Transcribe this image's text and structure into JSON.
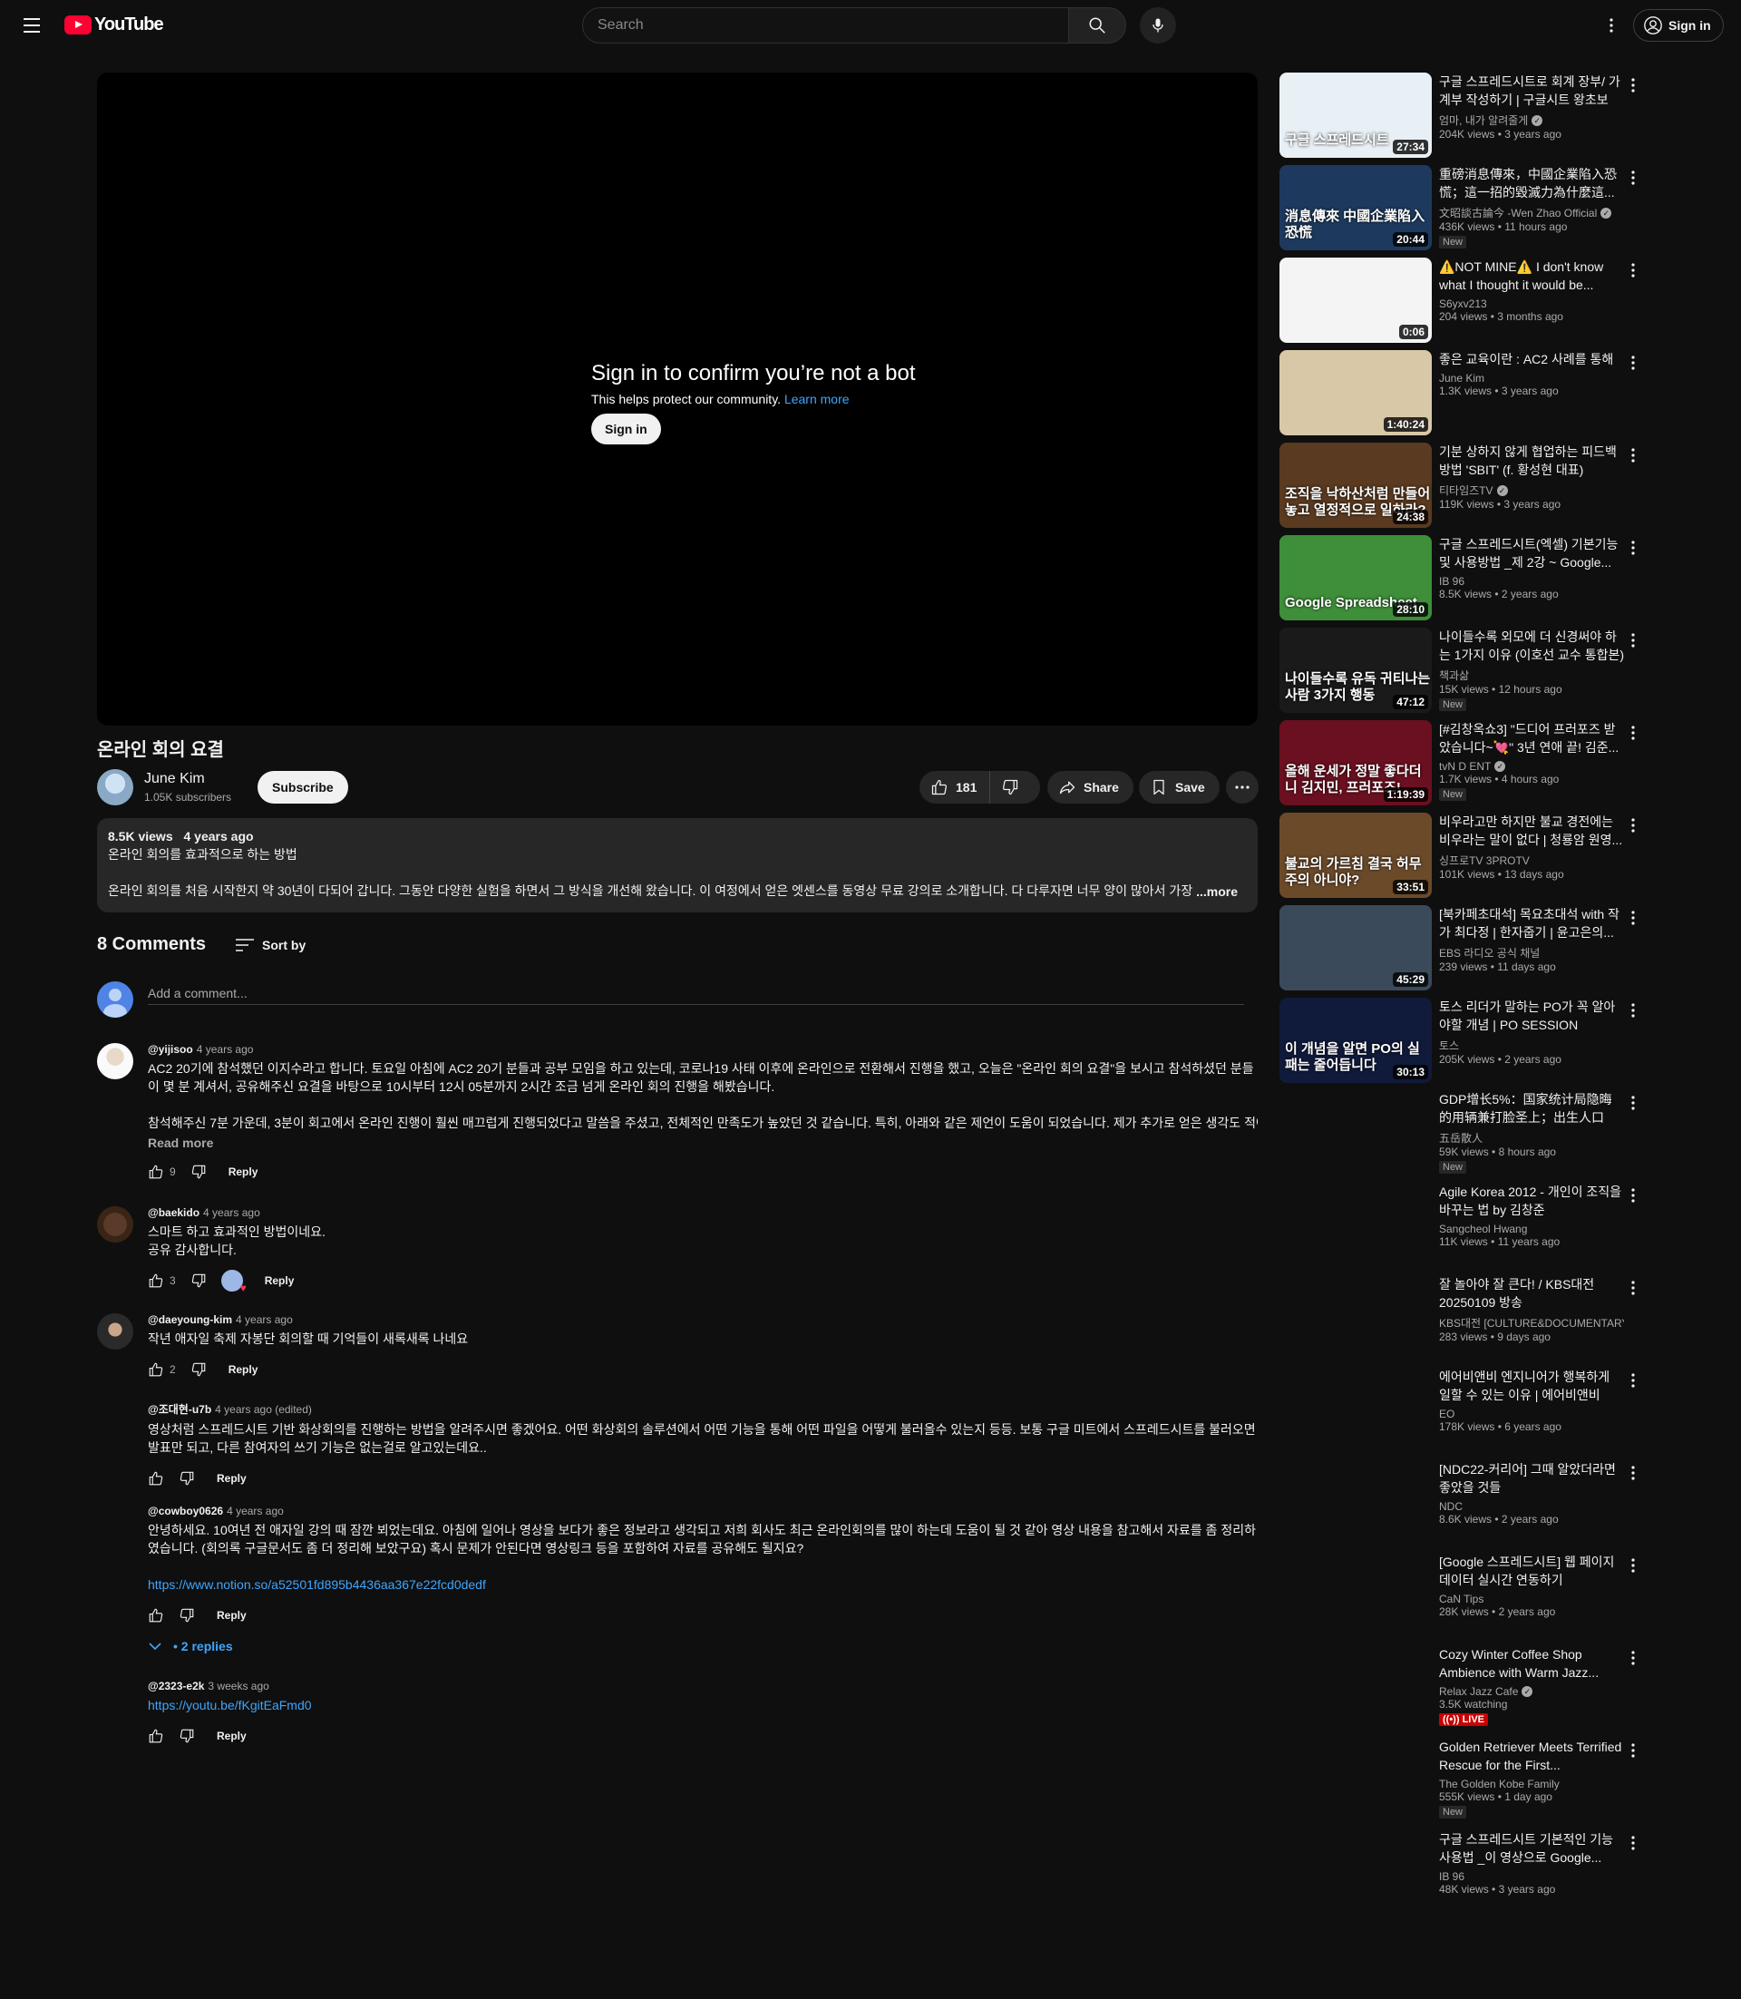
{
  "header": {
    "logo_text": "YouTube",
    "search_placeholder": "Search",
    "sign_in_label": "Sign in"
  },
  "player": {
    "bot_title": "Sign in to confirm you’re not a bot",
    "bot_subtitle": "This helps protect our community.",
    "learn_more": "Learn more",
    "sign_in_label": "Sign in"
  },
  "video": {
    "title": "온라인 회의 요결",
    "channel": "June Kim",
    "subscribers": "1.05K subscribers",
    "subscribe_label": "Subscribe",
    "likes": "181",
    "share_label": "Share",
    "save_label": "Save"
  },
  "description": {
    "views": "8.5K views",
    "age": "4 years ago",
    "line1": "온라인 회의를 효과적으로 하는 방법",
    "line2": "온라인 회의를 처음 시작한지 약 30년이 다되어 갑니다. 그동안 다양한 실험을 하면서 그 방식을 개선해 왔습니다. 이 여정에서 얻은 엣센스를 동영상 무료 강의로 소개합니다. 다 다루자면 너무 양이 많아서 가장 기",
    "more_label": "...more"
  },
  "comments": {
    "count_label": "8 Comments",
    "sort_label": "Sort by",
    "add_placeholder": "Add a comment...",
    "reply_label": "Reply",
    "read_more_label": "Read more",
    "replies_label": "2 replies",
    "items": [
      {
        "author": "@yijisoo",
        "time": "4 years ago",
        "text1": "AC2 20기에 참석했던 이지수라고 합니다. 토요일 아침에 AC2 20기 분들과 공부 모임을 하고 있는데, 코로나19 사태 이후에 온라인으로 전환해서 진행을 했고, 오늘은 \"온라인 회의 요결\"을 보시고 참석하셨던 분들이 몇 분 계셔서, 공유해주신 요결을 바탕으로 10시부터 12시 05분까지 2시간 조금 넘게 온라인 회의 진행을 해봤습니다.",
        "text2": "참석해주신 7분 가운데, 3분이 회고에서 온라인 진행이 훨씬 매끄럽게 진행되었다고 말씀을 주셨고, 전체적인 만족도가 높았던 것 같습니다. 특히, 아래와 같은 제언이 도움이 되었습니다. 제가 추가로 얻은 생각도 적어봅니다.",
        "likes": "9"
      },
      {
        "author": "@baekido",
        "time": "4 years ago",
        "text1": "스마트 하고 효과적인 방법이네요.",
        "text2": "공유 감사합니다.",
        "likes": "3"
      },
      {
        "author": "@daeyoung-kim",
        "time": "4 years ago",
        "text1": "작년 애자일 축제 자봉단 회의할 때 기억들이 새록새록 나네요",
        "likes": "2"
      },
      {
        "author": "@조대현-u7b",
        "time": "4 years ago (edited)",
        "text1": "영상처럼 스프레드시트 기반 화상회의를 진행하는 방법을 알려주시면 좋겠어요. 어떤 화상회의 솔루션에서 어떤 기능을 통해 어떤 파일을 어떻게 불러올수 있는지 등등. 보통 구글 미트에서 스프레드시트를 불러오면 발표만 되고, 다른 참여자의 쓰기 기능은 없는걸로 알고있는데요.."
      },
      {
        "author": "@cowboy0626",
        "time": "4 years ago",
        "text1": "안녕하세요. 10여년 전 애자일 강의 때 잠깐 뵈었는데요. 아침에 일어나 영상을 보다가 좋은 정보라고 생각되고 저희 회사도 최근 온라인회의를 많이 하는데 도움이 될 것 같아 영상 내용을 참고해서 자료를 좀 정리하였습니다. (회의록 구글문서도 좀 더 정리해 보았구요) 혹시 문제가 안된다면 영상링크 등을 포함하여 자료를 공유해도 될지요?",
        "link": "https://www.notion.so/a52501fd895b4436aa367e22fcd0dedf"
      },
      {
        "author": "@2323-e2k",
        "time": "3 weeks ago",
        "link": "https://youtu.be/fKgitEaFmd0"
      }
    ]
  },
  "sidebar": {
    "items": [
      {
        "title": "구글 스프레드시트로 회계 장부/ 가계부 작성하기 | 구글시트 왕초보 |...",
        "channel": "엄마, 내가 알려줄게",
        "verified": true,
        "views": "204K views",
        "age": "3 years ago",
        "duration": "27:34",
        "thumb_text": "구글 스프레드시트",
        "thumb_color": "#e8f0f5"
      },
      {
        "title": "重磅消息傳來，中國企業陷入恐慌；這一招的毀滅力為什麼這...",
        "channel": "文昭談古論今 -Wen Zhao Official",
        "verified": true,
        "views": "436K views",
        "age": "11 hours ago",
        "duration": "20:44",
        "badge": "New",
        "thumb_text": "消息傳來 中國企業陷入恐慌",
        "thumb_color": "#1d3a5e"
      },
      {
        "title": "⚠️NOT MINE⚠️ I don't know what I thought it would be...",
        "channel": "S6yxv213",
        "views": "204 views",
        "age": "3 months ago",
        "duration": "0:06",
        "thumb_text": "",
        "thumb_color": "#f4f4f4"
      },
      {
        "title": "좋은 교육이란 : AC2 사례를 통해",
        "channel": "June Kim",
        "views": "1.3K views",
        "age": "3 years ago",
        "duration": "1:40:24",
        "thumb_text": "",
        "thumb_color": "#d9c8a8"
      },
      {
        "title": "기분 상하지 않게 협업하는 피드백 방법 'SBIT' (f. 황성현 대표)",
        "channel": "티타임즈TV",
        "verified": true,
        "views": "119K views",
        "age": "3 years ago",
        "duration": "24:38",
        "thumb_text": "조직을 낙하산처럼 만들어놓고 열정적으로 일하라?",
        "thumb_color": "#5a3a20"
      },
      {
        "title": "구글 스프레드시트(엑셀) 기본기능 및 사용방법 _제 2강 ~ Google...",
        "channel": "IB 96",
        "views": "8.5K views",
        "age": "2 years ago",
        "duration": "28:10",
        "thumb_text": "Google Spreadsheet",
        "thumb_color": "#3e8e3a"
      },
      {
        "title": "나이들수록 외모에 더 신경써야 하는 1가지 이유 (이호선 교수 통합본)",
        "channel": "책과삶",
        "views": "15K views",
        "age": "12 hours ago",
        "duration": "47:12",
        "badge": "New",
        "thumb_text": "나이들수록 유독 귀티나는 사람 3가지 행동",
        "thumb_color": "#1a1a1a"
      },
      {
        "title": "[#김창옥쇼3] \"드디어 프러포즈 받았습니다~💘\" 3년 연애 끝! 김준...",
        "channel": "tvN D ENT",
        "verified": true,
        "views": "1.7K views",
        "age": "4 hours ago",
        "duration": "1:19:39",
        "badge": "New",
        "thumb_text": "올해 운세가 정말 좋다더니 김지민, 프러포즈!",
        "thumb_color": "#6a1020"
      },
      {
        "title": "비우라고만 하지만 불교 경전에는 비우라는 말이 없다 | 청룡암 원영...",
        "channel": "싱프로TV 3PROTV",
        "views": "101K views",
        "age": "13 days ago",
        "duration": "33:51",
        "thumb_text": "불교의 가르침 결국 허무주의 아니야?",
        "thumb_color": "#6b4a2a"
      },
      {
        "title": "[북카페초대석] 목요초대석 with 작가 최다정 | 한자줍기 | 윤고은의...",
        "channel": "EBS 라디오 공식 채널",
        "views": "239 views",
        "age": "11 days ago",
        "duration": "45:29",
        "thumb_text": "",
        "thumb_color": "#3a4a5a"
      },
      {
        "title": "토스 리더가 말하는 PO가 꼭 알아야할 개념 | PO SESSION",
        "channel": "토스",
        "views": "205K views",
        "age": "2 years ago",
        "duration": "30:13",
        "thumb_text": "이 개념을 알면 PO의 실패는 줄어듭니다",
        "thumb_color": "#101a3a"
      },
      {
        "title": "GDP增长5%：国家统计局隐晦的用辆兼打脸圣上；出生人口增...",
        "channel": "五岳散人",
        "views": "59K views",
        "age": "8 hours ago",
        "badge": "New",
        "no_thumb": true
      },
      {
        "title": "Agile Korea 2012 - 개인이 조직을 바꾸는 법 by 김창준",
        "channel": "Sangcheol Hwang",
        "views": "11K views",
        "age": "11 years ago",
        "no_thumb": true
      },
      {
        "title": "잘 놀아야 잘 큰다! / KBS대전 20250109 방송",
        "channel": "KBS대전 [CULTURE&DOCUMENTARY]",
        "views": "283 views",
        "age": "9 days ago",
        "no_thumb": true
      },
      {
        "title": "에어비앤비 엔지니어가 행복하게 일할 수 있는 이유 | 에어비앤비 엔...",
        "channel": "EO",
        "views": "178K views",
        "age": "6 years ago",
        "no_thumb": true
      },
      {
        "title": "[NDC22-커리어] 그때 알았더라면 좋았을 것들",
        "channel": "NDC",
        "views": "8.6K views",
        "age": "2 years ago",
        "no_thumb": true
      },
      {
        "title": "[Google 스프레드시트] 웹 페이지 데이터 실시간 연동하기",
        "channel": "CaN Tips",
        "views": "28K views",
        "age": "2 years ago",
        "no_thumb": true
      },
      {
        "title": "Cozy Winter Coffee Shop Ambience with Warm Jazz...",
        "channel": "Relax Jazz Cafe",
        "verified": true,
        "views": "3.5K watching",
        "age": "",
        "badge_live": "LIVE",
        "no_thumb": true
      },
      {
        "title": "Golden Retriever Meets Terrified Rescue for the First...",
        "channel": "The Golden Kobe Family",
        "views": "555K views",
        "age": "1 day ago",
        "badge": "New",
        "no_thumb": true
      },
      {
        "title": "구글 스프레드시트 기본적인 기능 사용법 _이 영상으로 Google...",
        "channel": "IB 96",
        "views": "48K views",
        "age": "3 years ago",
        "no_thumb": true
      }
    ]
  }
}
